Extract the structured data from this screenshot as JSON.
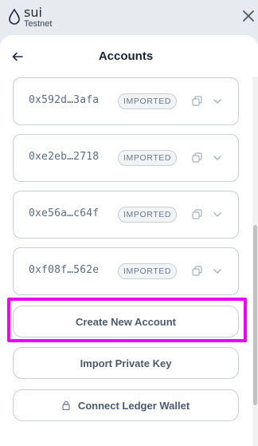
{
  "app": {
    "brand": "sui",
    "network": "Testnet"
  },
  "header": {
    "title": "Accounts"
  },
  "accounts": [
    {
      "address": "0x592d…3afa",
      "badge": "IMPORTED"
    },
    {
      "address": "0xe2eb…2718",
      "badge": "IMPORTED"
    },
    {
      "address": "0xe56a…c64f",
      "badge": "IMPORTED"
    },
    {
      "address": "0xf08f…562e",
      "badge": "IMPORTED"
    }
  ],
  "actions": {
    "create": "Create New Account",
    "import": "Import Private Key",
    "ledger": "Connect Ledger Wallet"
  },
  "icons": {
    "logo": "sui-drop-icon",
    "close": "close-icon",
    "back": "arrow-left-icon",
    "copy": "copy-icon",
    "expand": "chevron-down-icon",
    "lock": "lock-icon"
  },
  "colors": {
    "highlight": "#f000f0",
    "brand": "#1f2c3a"
  }
}
